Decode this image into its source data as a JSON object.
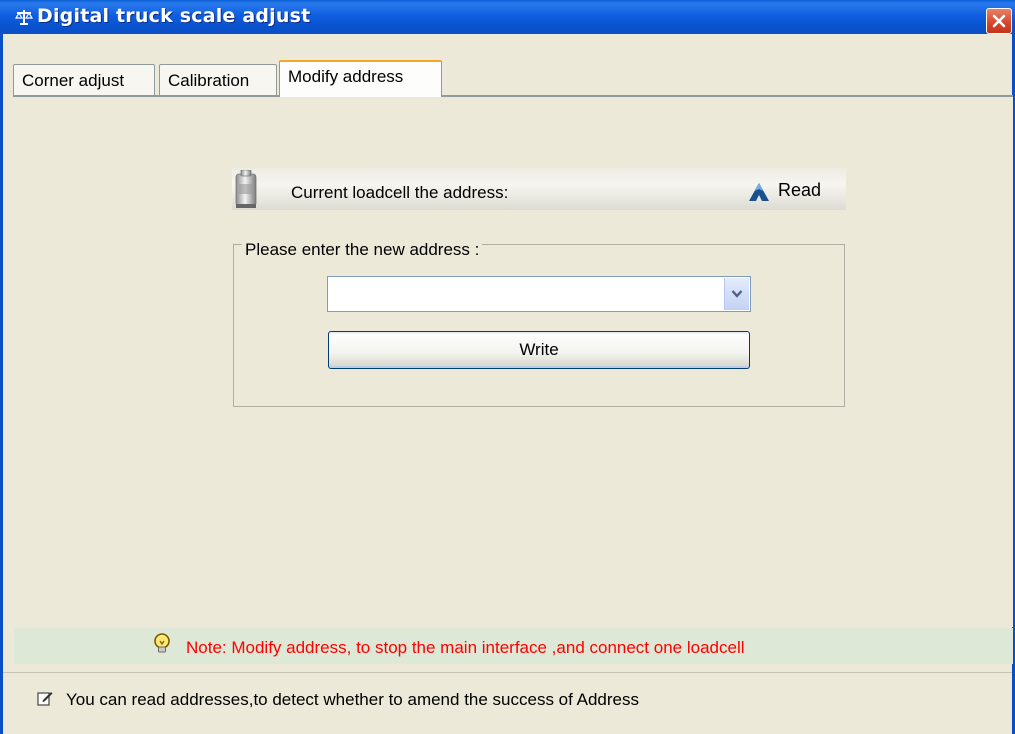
{
  "window": {
    "title": "Digital truck scale adjust"
  },
  "tabs": [
    {
      "label": "Corner adjust",
      "active": false
    },
    {
      "label": "Calibration",
      "active": false
    },
    {
      "label": "Modify address",
      "active": true
    }
  ],
  "read_section": {
    "current_label": "Current loadcell  the address:",
    "read_label": "Read"
  },
  "address_group": {
    "legend": "Please enter the new address :",
    "select_value": "",
    "write_label": "Write"
  },
  "note": {
    "text": "Note: Modify address, to stop the main interface ,and  connect one loadcell",
    "color": "#ff0000"
  },
  "status": {
    "text": "You can read addresses,to detect whether to amend the success of Address"
  },
  "colors": {
    "titlebar": "#0a53d0",
    "window_bg": "#ece9d8",
    "note_bg": "#dde9d6",
    "close_button": "#d6452a"
  }
}
